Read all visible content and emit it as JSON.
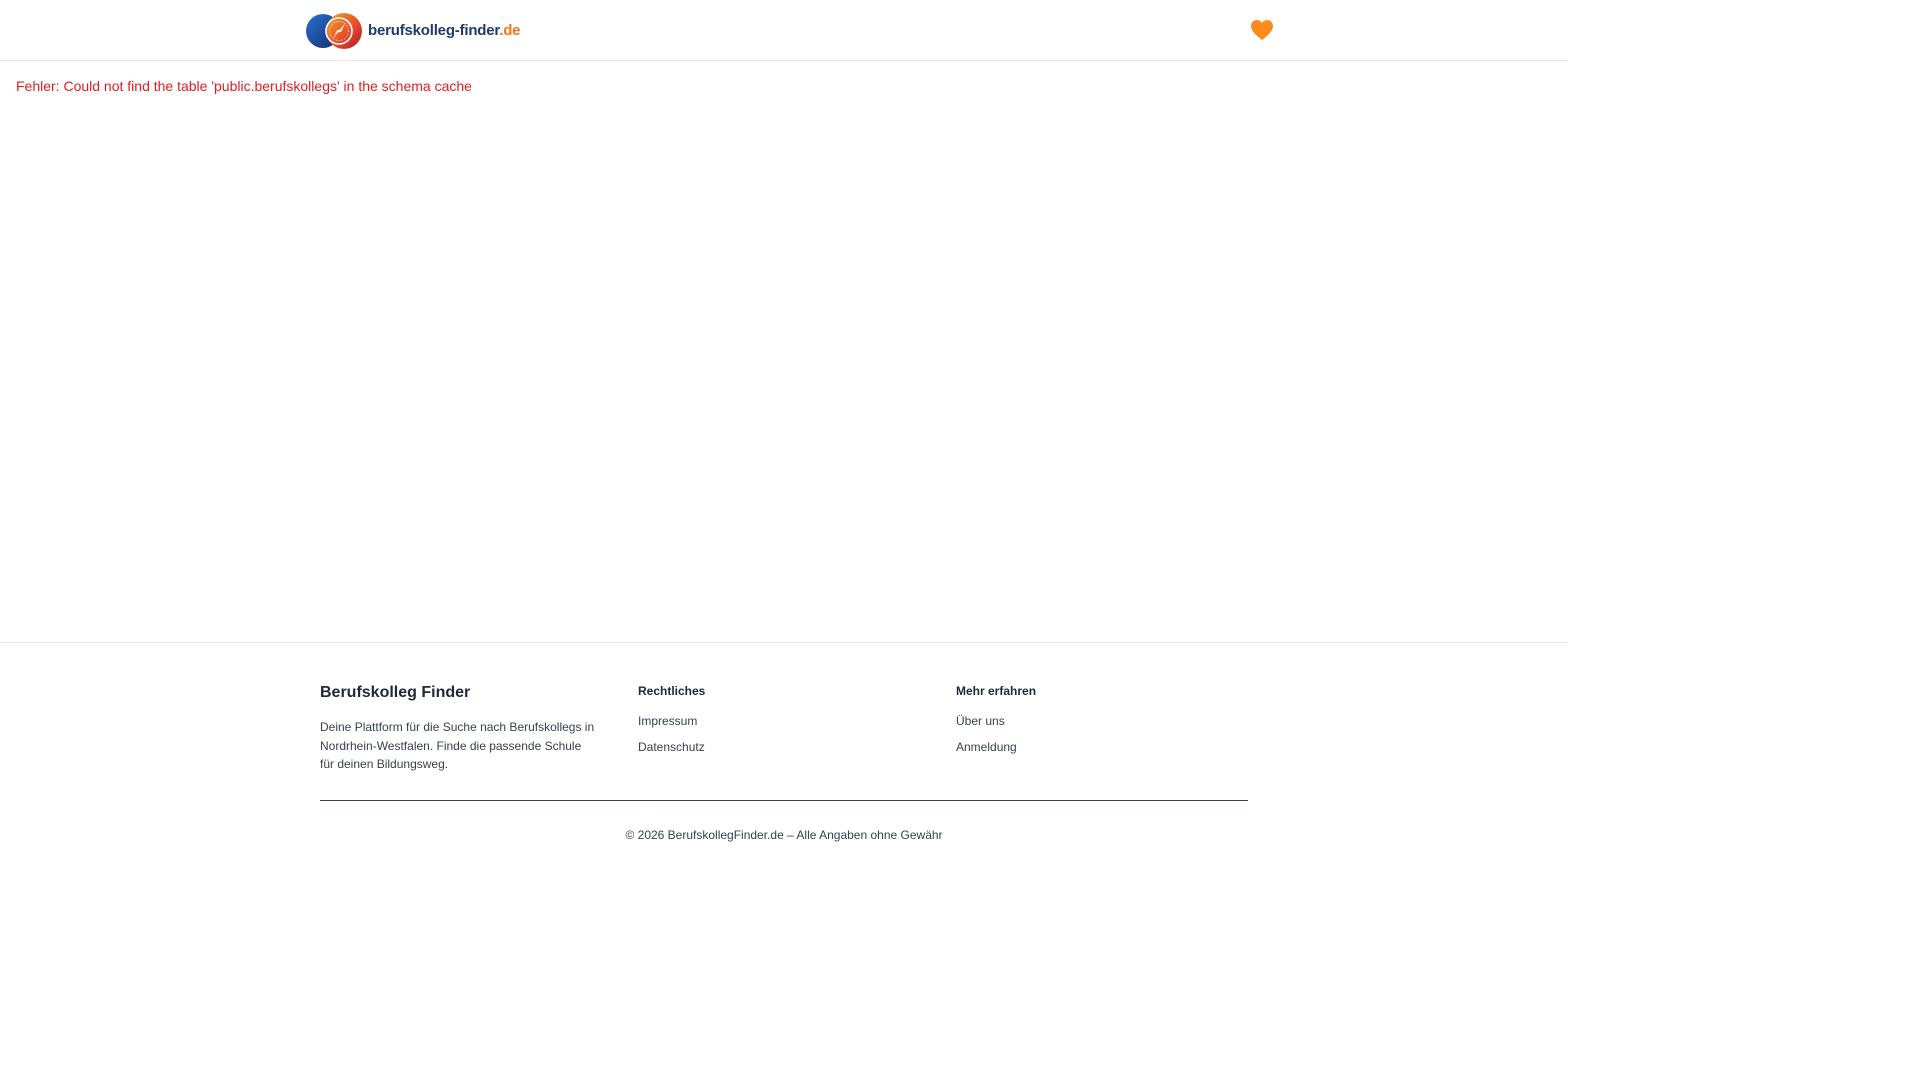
{
  "header": {
    "logo_text": "berufskolleg-finder",
    "logo_tld": ".de",
    "favorites_icon": "heart-icon",
    "colors": {
      "brand_blue": "#1e3a6e",
      "brand_orange": "#f97316",
      "heart": "#fb8c1c"
    }
  },
  "main": {
    "error_message": "Fehler: Could not find the table 'public.berufskollegs' in the schema cache",
    "error_color": "#e11d1d"
  },
  "footer": {
    "about": {
      "title": "Berufskolleg Finder",
      "description": "Deine Plattform für die Suche nach Berufskollegs in Nordrhein-Westfalen. Finde die passende Schule für deinen Bildungsweg."
    },
    "legal": {
      "title": "Rechtliches",
      "links": [
        {
          "label": "Impressum"
        },
        {
          "label": "Datenschutz"
        }
      ]
    },
    "more": {
      "title": "Mehr erfahren",
      "links": [
        {
          "label": "Über uns"
        },
        {
          "label": "Anmeldung"
        }
      ]
    },
    "copyright": "© 2026 BerufskollegFinder.de – Alle Angaben ohne Gewähr"
  }
}
